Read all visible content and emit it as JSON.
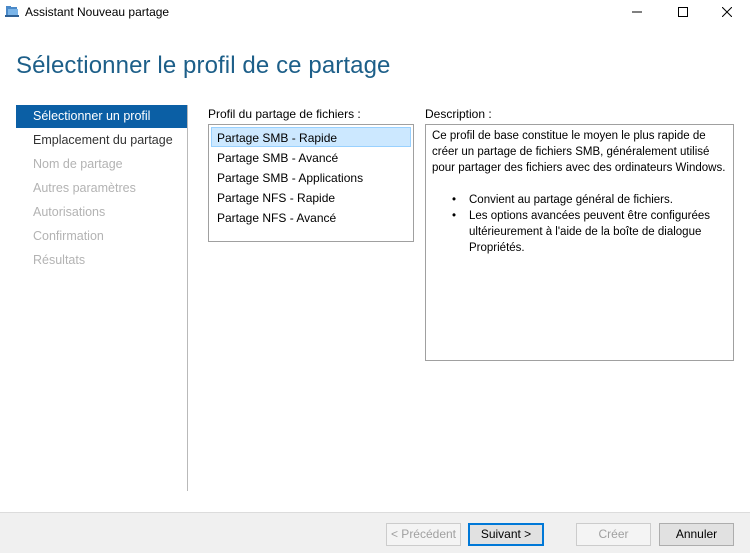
{
  "window": {
    "title": "Assistant Nouveau partage",
    "icon": "share-folder-icon",
    "controls": [
      "minimize-icon",
      "maximize-icon",
      "close-icon"
    ]
  },
  "page_title": "Sélectionner le profil de ce partage",
  "nav": {
    "items": [
      {
        "label": "Sélectionner un profil",
        "state": "active"
      },
      {
        "label": "Emplacement du partage",
        "state": "enabled"
      },
      {
        "label": "Nom de partage",
        "state": "disabled"
      },
      {
        "label": "Autres paramètres",
        "state": "disabled"
      },
      {
        "label": "Autorisations",
        "state": "disabled"
      },
      {
        "label": "Confirmation",
        "state": "disabled"
      },
      {
        "label": "Résultats",
        "state": "disabled"
      }
    ]
  },
  "profiles": {
    "label": "Profil du partage de fichiers :",
    "items": [
      "Partage SMB - Rapide",
      "Partage SMB - Avancé",
      "Partage SMB - Applications",
      "Partage NFS - Rapide",
      "Partage NFS - Avancé"
    ],
    "selected": "Partage SMB - Rapide"
  },
  "description": {
    "label": "Description :",
    "intro": "Ce profil de base constitue le moyen le plus rapide de créer un partage de fichiers SMB, généralement utilisé pour partager des fichiers avec des ordinateurs Windows.",
    "bullets": [
      "Convient au partage général de fichiers.",
      "Les options avancées peuvent être configurées ultérieurement à l'aide de la boîte de dialogue Propriétés."
    ]
  },
  "footer": {
    "previous": "< Précédent",
    "next": "Suivant >",
    "create": "Créer",
    "cancel": "Annuler"
  },
  "colors": {
    "accent": "#0b5fa5",
    "title": "#1d5f89",
    "selection": "#cce8ff"
  }
}
